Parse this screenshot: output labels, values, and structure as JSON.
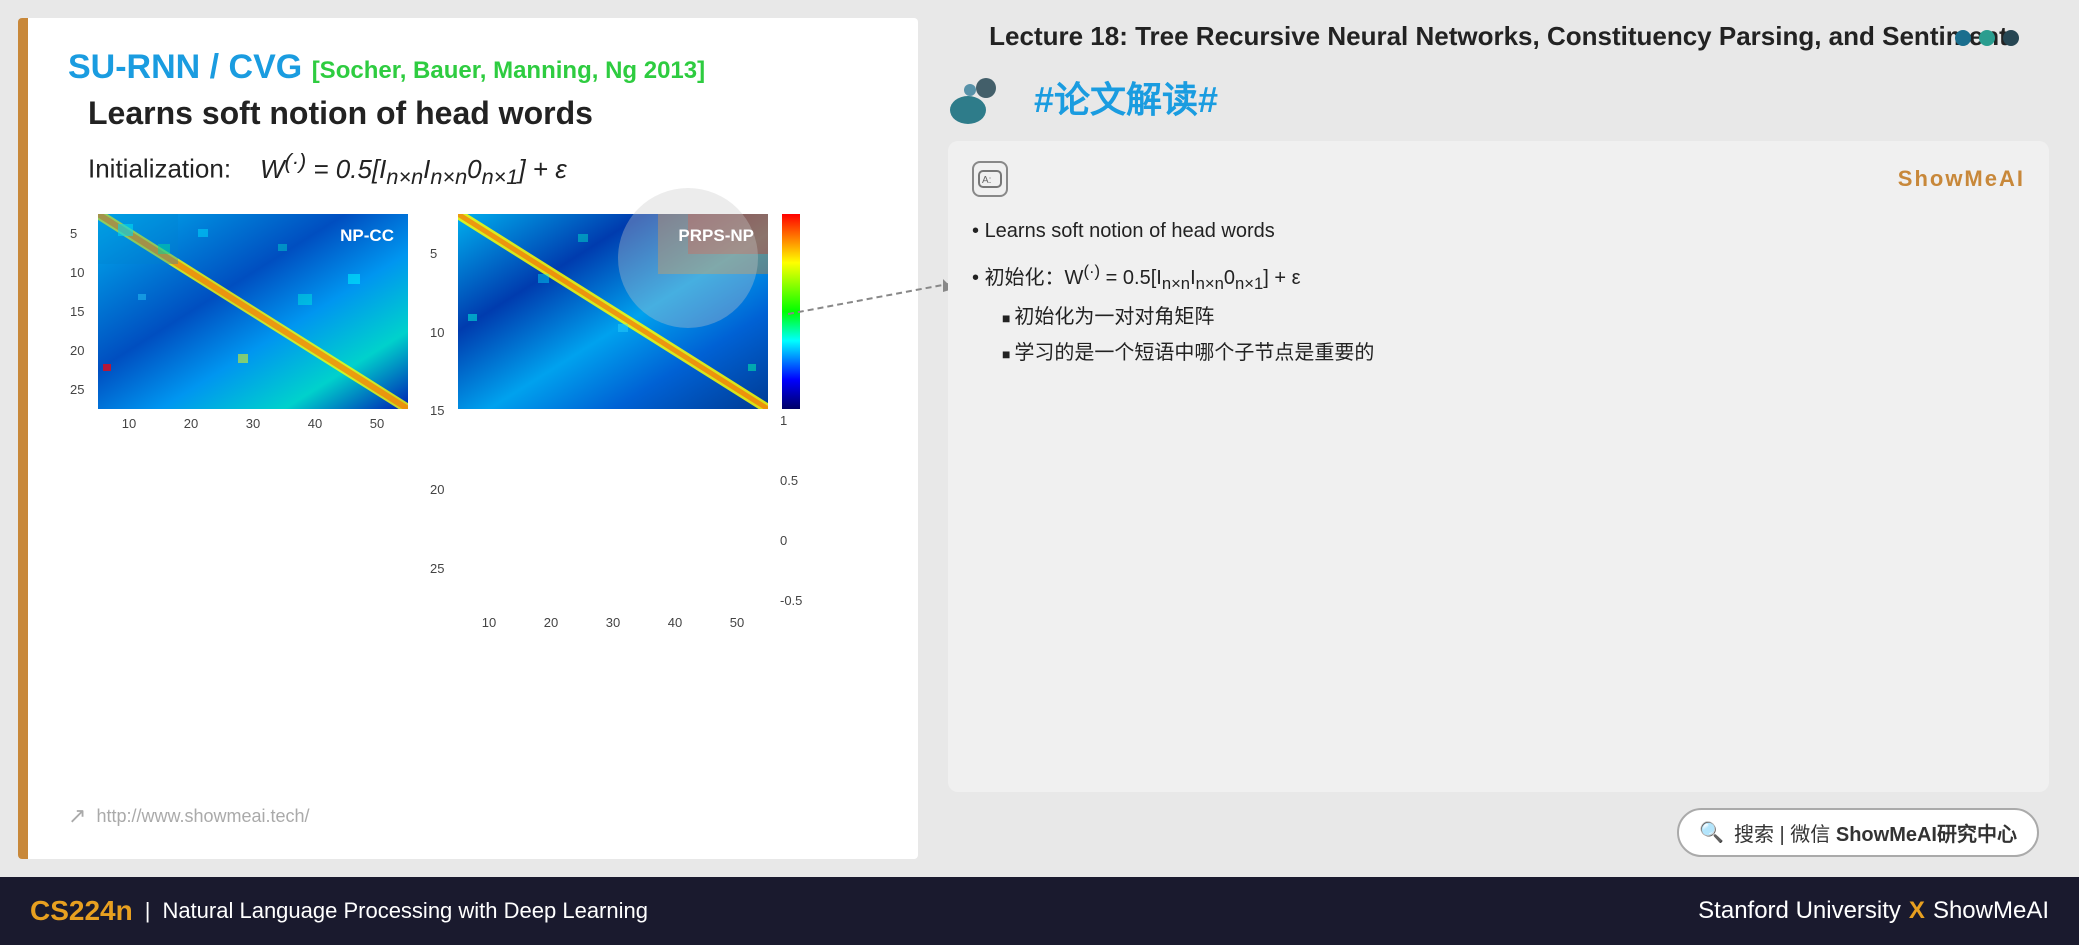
{
  "slide": {
    "title": "SU-RNN / CVG",
    "title_ref": "[Socher, Bauer, Manning, Ng 2013]",
    "subtitle": "Learns soft notion of head words",
    "formula_label": "Initialization:",
    "formula": "W(·) = 0.5[In×nIn×n0n×1] + ε",
    "formula_display": "W^{(·)} = 0.5[I_{n×n}I_{n×n}0_{n×1}] + ε",
    "matrix1_label": "NP-CC",
    "matrix2_label": "PRPS-NP",
    "y_axis": [
      "5",
      "10",
      "15",
      "20",
      "25"
    ],
    "x_axis": [
      "10",
      "20",
      "30",
      "40",
      "50"
    ],
    "colorbar_max": "1",
    "colorbar_mid1": "0.5",
    "colorbar_mid2": "0",
    "colorbar_min": "-0.5",
    "footer_url": "http://www.showmeai.tech/"
  },
  "right_panel": {
    "lecture_title": "Lecture 18: Tree Recursive Neural Networks, Constituency Parsing, and Sentiment",
    "hashtag": "#论文解读#",
    "dots": [
      "#1a6e8e",
      "#2a9d8f",
      "#264653"
    ],
    "annotation_box": {
      "ai_icon": "A:",
      "brand": "ShowMeAI",
      "items": [
        {
          "text": "Learns soft notion of head words",
          "subitems": []
        },
        {
          "text": "初始化：W^(·) = 0.5[In×nIn×n0n×1] + ε",
          "subitems": [
            "初始化为一对对角矩阵",
            "学习的是一个短语中哪个子节点是重要的"
          ]
        }
      ]
    },
    "search_bar": {
      "icon": "🔍",
      "text": "搜索 | 微信 ShowMeAI研究中心"
    }
  },
  "bottom_bar": {
    "course_code": "CS224n",
    "divider": "|",
    "course_name": "Natural Language Processing with Deep Learning",
    "university": "Stanford University",
    "x_label": "X",
    "brand": "ShowMeAI"
  }
}
